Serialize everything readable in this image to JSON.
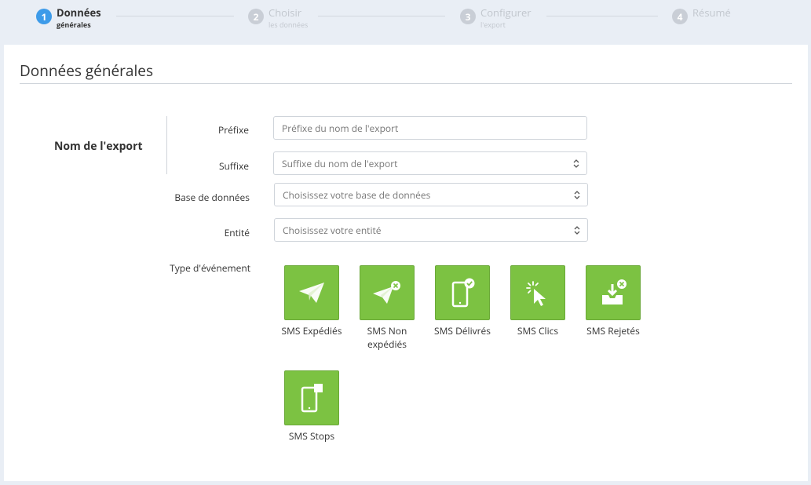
{
  "stepper": {
    "steps": [
      {
        "num": "1",
        "title": "Données",
        "sub": "générales"
      },
      {
        "num": "2",
        "title": "Choisir",
        "sub": "les données"
      },
      {
        "num": "3",
        "title": "Configurer",
        "sub": "l'export"
      },
      {
        "num": "4",
        "title": "Résumé",
        "sub": ""
      }
    ]
  },
  "card": {
    "title": "Données générales",
    "group_label": "Nom de l'export",
    "prefix": {
      "label": "Préfixe",
      "placeholder": "Préfixe du nom de l'export"
    },
    "suffix": {
      "label": "Suffixe",
      "placeholder": "Suffixe du nom de l'export"
    },
    "database": {
      "label": "Base de données",
      "placeholder": "Choisissez votre base de données"
    },
    "entity": {
      "label": "Entité",
      "placeholder": "Choisissez votre entité"
    },
    "event_type": {
      "label": "Type d'événement",
      "tiles": [
        {
          "label": "SMS Expédiés",
          "icon": "paper-plane-icon"
        },
        {
          "label": "SMS Non expédiés",
          "icon": "paper-plane-x-icon"
        },
        {
          "label": "SMS Délivrés",
          "icon": "phone-check-icon"
        },
        {
          "label": "SMS Clics",
          "icon": "cursor-click-icon"
        },
        {
          "label": "SMS Rejetés",
          "icon": "inbox-x-icon"
        },
        {
          "label": "SMS Stops",
          "icon": "phone-stop-icon"
        }
      ]
    }
  },
  "colors": {
    "accent": "#3d9be9",
    "tile": "#7cc242"
  }
}
